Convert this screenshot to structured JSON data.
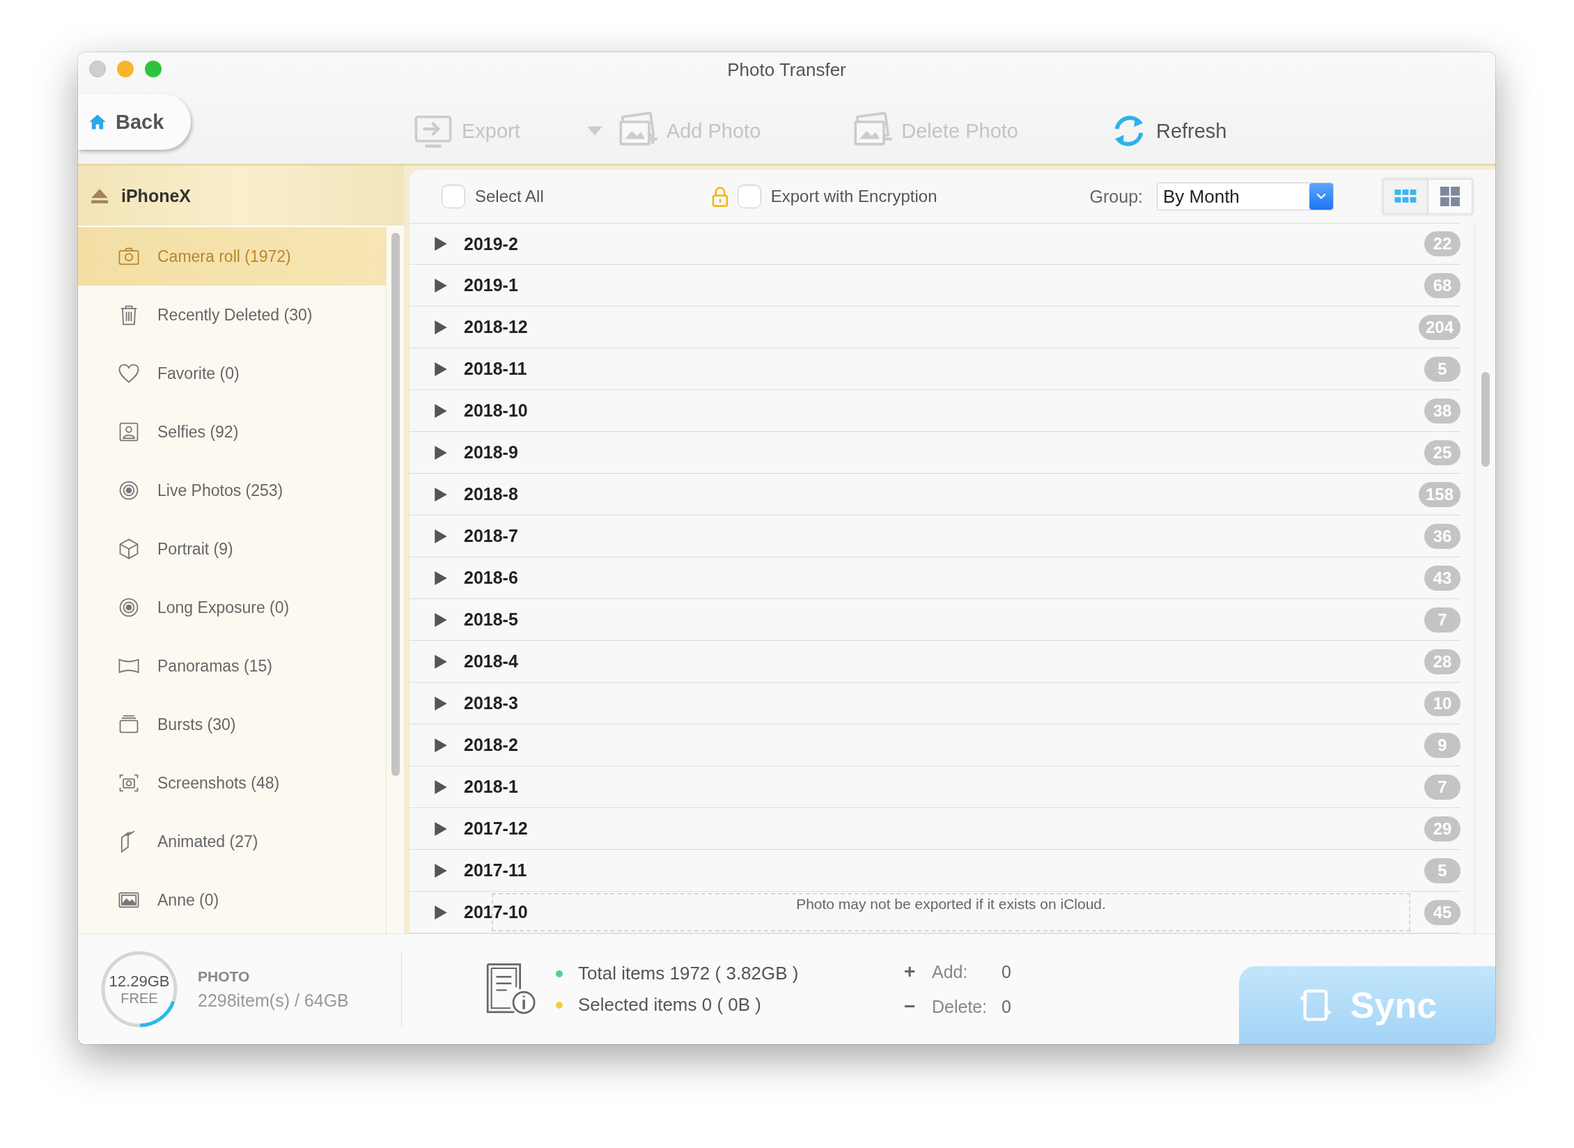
{
  "window": {
    "title": "Photo Transfer"
  },
  "toolbar": {
    "back": "Back",
    "actions": [
      {
        "label": "Export",
        "disabled": true,
        "has_menu": true
      },
      {
        "label": "Add Photo",
        "disabled": true,
        "has_menu": false
      },
      {
        "label": "Delete Photo",
        "disabled": true,
        "has_menu": false
      },
      {
        "label": "Refresh",
        "disabled": false,
        "has_menu": false
      }
    ]
  },
  "device": {
    "name": "iPhoneX"
  },
  "albums": [
    {
      "label": "Camera roll (1972)",
      "selected": true
    },
    {
      "label": "Recently Deleted (30)",
      "selected": false
    },
    {
      "label": "Favorite (0)",
      "selected": false
    },
    {
      "label": "Selfies (92)",
      "selected": false
    },
    {
      "label": "Live Photos (253)",
      "selected": false
    },
    {
      "label": "Portrait (9)",
      "selected": false
    },
    {
      "label": "Long Exposure (0)",
      "selected": false
    },
    {
      "label": "Panoramas (15)",
      "selected": false
    },
    {
      "label": "Bursts (30)",
      "selected": false
    },
    {
      "label": "Screenshots (48)",
      "selected": false
    },
    {
      "label": "Animated (27)",
      "selected": false
    },
    {
      "label": "Anne (0)",
      "selected": false
    }
  ],
  "list_header": {
    "select_all": {
      "label": "Select All",
      "checked": false
    },
    "encryption": {
      "label": "Export with Encryption",
      "checked": false
    },
    "group_label": "Group:",
    "group_value": "By Month",
    "views": [
      {
        "selected": true
      },
      {
        "selected": false
      }
    ]
  },
  "rows": [
    {
      "label": "2019-2",
      "count": "22",
      "expanded": false
    },
    {
      "label": "2019-1",
      "count": "68",
      "expanded": false
    },
    {
      "label": "2018-12",
      "count": "204",
      "expanded": false
    },
    {
      "label": "2018-11",
      "count": "5",
      "expanded": false
    },
    {
      "label": "2018-10",
      "count": "38",
      "expanded": false
    },
    {
      "label": "2018-9",
      "count": "25",
      "expanded": false
    },
    {
      "label": "2018-8",
      "count": "158",
      "expanded": false
    },
    {
      "label": "2018-7",
      "count": "36",
      "expanded": false
    },
    {
      "label": "2018-6",
      "count": "43",
      "expanded": false
    },
    {
      "label": "2018-5",
      "count": "7",
      "expanded": false
    },
    {
      "label": "2018-4",
      "count": "28",
      "expanded": false
    },
    {
      "label": "2018-3",
      "count": "10",
      "expanded": false
    },
    {
      "label": "2018-2",
      "count": "9",
      "expanded": false
    },
    {
      "label": "2018-1",
      "count": "7",
      "expanded": false
    },
    {
      "label": "2017-12",
      "count": "29",
      "expanded": false
    },
    {
      "label": "2017-11",
      "count": "5",
      "expanded": false
    },
    {
      "label": "2017-10",
      "count": "45",
      "expanded": false,
      "notice": "Photo may not be exported if it exists on iCloud."
    }
  ],
  "storage": {
    "free": "12.29GB",
    "free_label": "FREE",
    "type": "PHOTO",
    "usage": "2298item(s) / 64GB",
    "level": 0.19
  },
  "summary": [
    {
      "text": "Total items 1972 ( 3.82GB )",
      "color": "#4cd58a"
    },
    {
      "text": "Selected items 0 ( 0B )",
      "color": "#f5cc3c"
    }
  ],
  "changes": [
    {
      "sign": "+",
      "label": "Add:",
      "value": "0"
    },
    {
      "sign": "−",
      "label": "Delete:",
      "value": "0"
    }
  ],
  "sync": "Sync"
}
